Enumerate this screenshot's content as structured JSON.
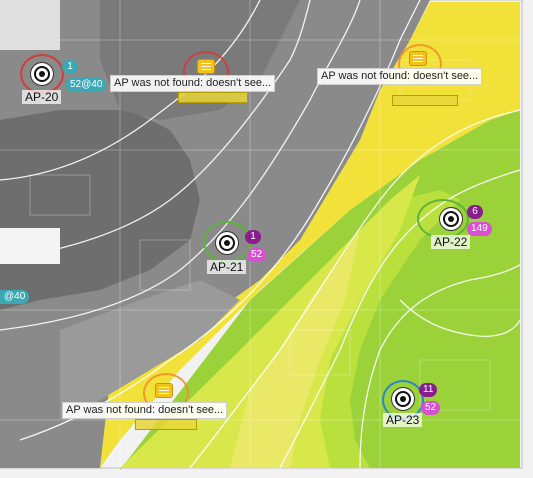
{
  "colors": {
    "gray_dark": "#6e6e6e",
    "gray_mid": "#8a8a8a",
    "gray_light": "#a6a6a6",
    "yellow": "#f1e138",
    "yellow_pale": "#ece86a",
    "yellow_green": "#d8e84a",
    "green_light": "#b9e03d",
    "green": "#9bd23a",
    "teal_badge": "#3aa9b5",
    "purple_badge": "#8a1e8f",
    "pink_badge": "#d94fd1",
    "ring_red": "#d33a3a",
    "ring_green": "#5fb33a",
    "ring_blue": "#2f86c8",
    "ring_orange": "#f08c2c"
  },
  "access_points": [
    {
      "name": "AP-20",
      "icon": "ap-target-icon",
      "top_badge": "1",
      "bottom_badge": "52@40",
      "badge_color": "teal",
      "ring_color": "red"
    },
    {
      "name": "AP-21",
      "icon": "ap-target-icon",
      "top_badge": "1",
      "bottom_badge": "52",
      "badge_color": "purple-pink",
      "ring_color": "green"
    },
    {
      "name": "AP-22",
      "icon": "ap-target-icon",
      "top_badge": "6",
      "bottom_badge": "149",
      "badge_color": "purple-pink",
      "ring_color": "green"
    },
    {
      "name": "AP-23",
      "icon": "ap-target-icon",
      "top_badge": "11",
      "bottom_badge": "52",
      "badge_color": "purple-pink",
      "ring_color": "blue"
    }
  ],
  "messages": [
    "AP was not found: doesn't see...",
    "AP was not found: doesn't see...",
    "AP was not found: doesn't see..."
  ],
  "edge_badge": "@40"
}
